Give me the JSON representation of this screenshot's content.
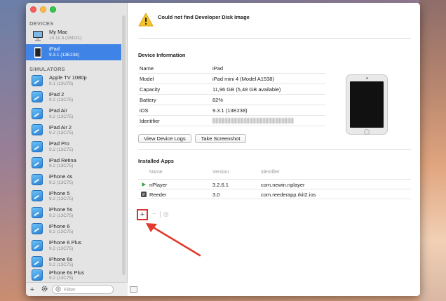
{
  "sidebar": {
    "devices_label": "DEVICES",
    "devices": [
      {
        "name": "My Mac",
        "sub": "10.11.3 (15D21)"
      },
      {
        "name": "iPad",
        "sub": "9.3.1 (13E238)"
      }
    ],
    "simulators_label": "SIMULATORS",
    "simulators": [
      {
        "name": "Apple TV 1080p",
        "sub": "9.1 (13U79)"
      },
      {
        "name": "iPad 2",
        "sub": "9.2 (13C75)"
      },
      {
        "name": "iPad Air",
        "sub": "9.2 (13C75)"
      },
      {
        "name": "iPad Air 2",
        "sub": "9.2 (13C75)"
      },
      {
        "name": "iPad Pro",
        "sub": "9.2 (13C75)"
      },
      {
        "name": "iPad Retina",
        "sub": "9.2 (13C75)"
      },
      {
        "name": "iPhone 4s",
        "sub": "9.2 (13C75)"
      },
      {
        "name": "iPhone 5",
        "sub": "9.2 (13C75)"
      },
      {
        "name": "iPhone 5s",
        "sub": "9.2 (13C75)"
      },
      {
        "name": "iPhone 6",
        "sub": "9.2 (13C75)"
      },
      {
        "name": "iPhone 6 Plus",
        "sub": "9.2 (13C75)"
      },
      {
        "name": "iPhone 6s",
        "sub": "9.2 (13C75)"
      },
      {
        "name": "iPhone 6s Plus",
        "sub": "9.2 (13C75)"
      }
    ],
    "filter_placeholder": "Filter",
    "add_label": "+"
  },
  "main": {
    "error_title": "Could not find Developer Disk Image",
    "device_info_heading": "Device Information",
    "info": [
      {
        "key": "Name",
        "value": "iPad"
      },
      {
        "key": "Model",
        "value": "iPad mini 4 (Model A1538)"
      },
      {
        "key": "Capacity",
        "value": "11,96 GB (5,48 GB available)"
      },
      {
        "key": "Battery",
        "value": "82%"
      },
      {
        "key": "iOS",
        "value": "9.3.1 (13E238)"
      },
      {
        "key": "Identifier",
        "value": ""
      }
    ],
    "view_logs_label": "View Device Logs",
    "screenshot_label": "Take Screenshot",
    "installed_heading": "Installed Apps",
    "columns": {
      "name": "Name",
      "version": "Version",
      "identifier": "Identifier"
    },
    "apps": [
      {
        "name": "nPlayer",
        "version": "3.2.6.1",
        "identifier": "com.newin.nplayer"
      },
      {
        "name": "Reeder",
        "version": "3.0",
        "identifier": "com.reederapp.rkit2.ios"
      }
    ],
    "add_app_label": "+",
    "remove_app_label": "−"
  },
  "colors": {
    "selection": "#3f83e6",
    "highlight": "#d8322e"
  }
}
